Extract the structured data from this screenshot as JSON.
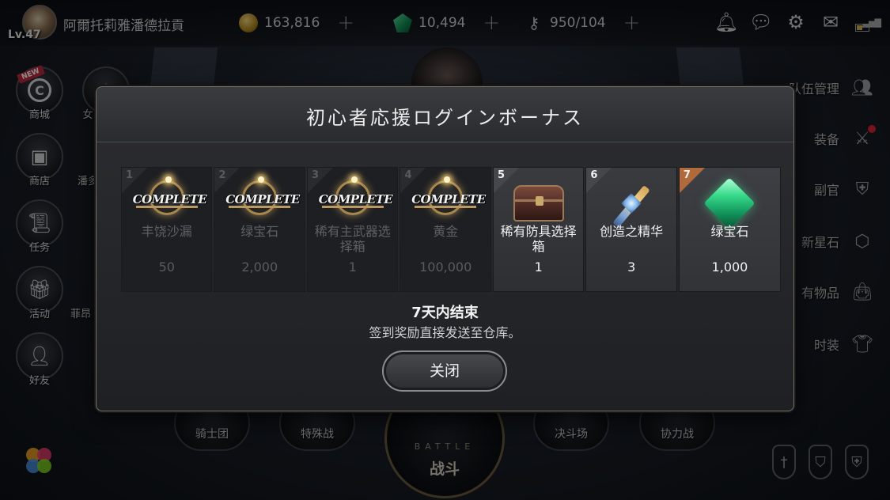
{
  "player": {
    "name": "阿爾托莉雅潘德拉貢",
    "level": "Lv.47"
  },
  "resources": {
    "gold": "163,816",
    "gems": "10,494",
    "stamina": "950/104",
    "plus_symbol": "+"
  },
  "left_menu": {
    "new_tag": "NEW",
    "items": [
      {
        "label": "商城",
        "icon": "c-coin-icon"
      },
      {
        "label": "商店",
        "icon": "chest-icon"
      },
      {
        "label": "任务",
        "icon": "scroll-icon"
      },
      {
        "label": "活动",
        "icon": "gift-icon"
      },
      {
        "label": "好友",
        "icon": "add-friend-icon"
      }
    ],
    "partial_labels": [
      "女",
      "潘多",
      "菲昂"
    ]
  },
  "right_menu": {
    "items": [
      {
        "label": "队伍管理",
        "icon": "team-icon"
      },
      {
        "label": "装备",
        "icon": "crossed-swords-icon"
      },
      {
        "label": "副官",
        "icon": "helmet-icon"
      },
      {
        "label": "新星石",
        "icon": "star-stone-icon"
      },
      {
        "label": "有物品",
        "icon": "bag-icon"
      },
      {
        "label": "时装",
        "icon": "costume-icon"
      }
    ]
  },
  "bottom_menu": {
    "items": [
      {
        "label": "骑士团"
      },
      {
        "label": "特殊战"
      },
      {
        "label": "决斗场"
      },
      {
        "label": "协力战"
      }
    ],
    "battle_en": "BATTLE",
    "battle_cn": "战斗"
  },
  "dialog": {
    "title": "初心者応援ログインボーナス",
    "complete_stamp": "COMPLETE",
    "slots": [
      {
        "day": "1",
        "name": "丰饶沙漏",
        "qty": "50",
        "status": "complete"
      },
      {
        "day": "2",
        "name": "绿宝石",
        "qty": "2,000",
        "status": "complete"
      },
      {
        "day": "3",
        "name": "稀有主武器选择箱",
        "qty": "1",
        "status": "complete"
      },
      {
        "day": "4",
        "name": "黄金",
        "qty": "100,000",
        "status": "complete"
      },
      {
        "day": "5",
        "name": "稀有防具选择箱",
        "qty": "1",
        "status": "upcoming",
        "icon": "armor-chest-icon"
      },
      {
        "day": "6",
        "name": "创造之精华",
        "qty": "3",
        "status": "upcoming",
        "icon": "essence-icon"
      },
      {
        "day": "7",
        "name": "绿宝石",
        "qty": "1,000",
        "status": "final",
        "icon": "emerald-icon"
      }
    ],
    "end_notice": "7天内结束",
    "sub_notice": "签到奖励直接发送至仓库。",
    "close_label": "关闭"
  },
  "colors": {
    "dialog_border": "#7a6f5c",
    "final_corner": "#b06a3c",
    "emerald": "#36d98a",
    "notification_dot": "#d9232e"
  }
}
